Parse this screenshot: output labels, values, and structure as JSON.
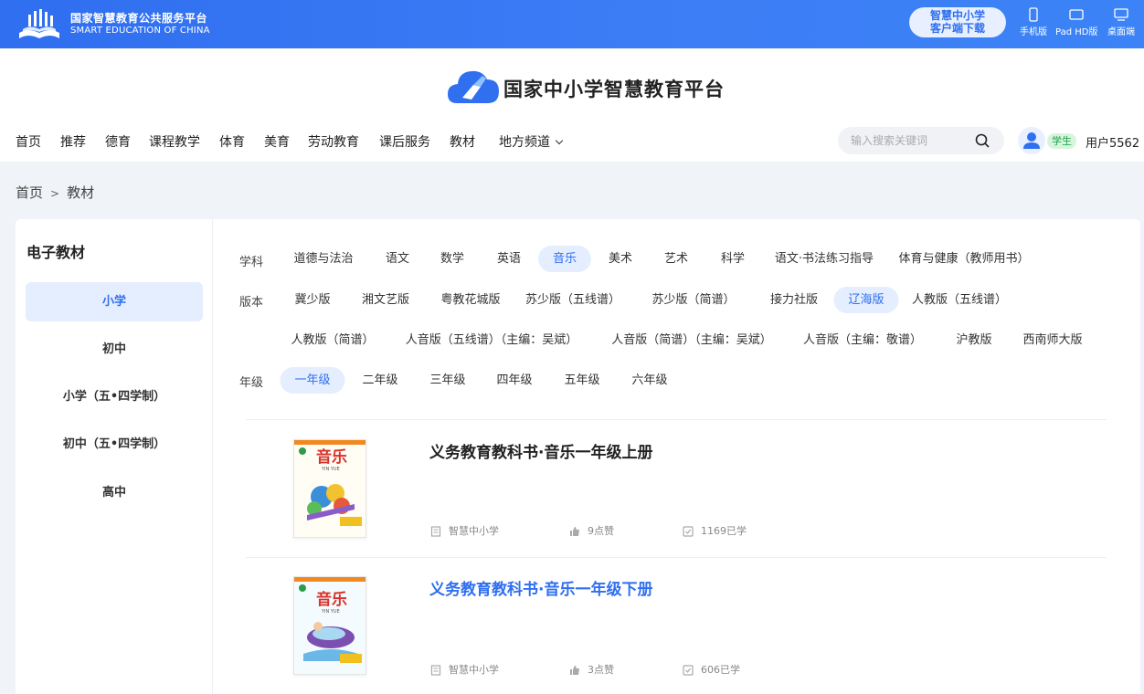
{
  "topbar": {
    "brand_cn": "国家智慧教育公共服务平台",
    "brand_en": "SMART EDUCATION OF CHINA",
    "download_line1": "智慧中小学",
    "download_line2": "客户端下载",
    "devices": [
      "手机版",
      "Pad HD版",
      "桌面端"
    ]
  },
  "header": {
    "site_title": "国家中小学智慧教育平台",
    "nav": [
      "首页",
      "推荐",
      "德育",
      "课程教学",
      "体育",
      "美育",
      "劳动教育",
      "课后服务",
      "教材",
      "地方频道"
    ],
    "search_placeholder": "输入搜索关键词",
    "role_badge": "学生",
    "user_name": "用户5562"
  },
  "breadcrumb": {
    "home": "首页",
    "sep": ">",
    "current": "教材"
  },
  "sidebar": {
    "title": "电子教材",
    "items": [
      "小学",
      "初中",
      "小学（五•四学制）",
      "初中（五•四学制）",
      "高中"
    ],
    "active_index": 0
  },
  "filters": {
    "subject_label": "学科",
    "subjects": [
      "道德与法治",
      "语文",
      "数学",
      "英语",
      "音乐",
      "美术",
      "艺术",
      "科学",
      "语文·书法练习指导",
      "体育与健康（教师用书）"
    ],
    "subject_active": "音乐",
    "edition_label": "版本",
    "editions_row1": [
      "冀少版",
      "湘文艺版",
      "粤教花城版",
      "苏少版（五线谱）",
      "苏少版（简谱）",
      "接力社版",
      "辽海版",
      "人教版（五线谱）"
    ],
    "editions_row2": [
      "人教版（简谱）",
      "人音版（五线谱）（主编：吴斌）",
      "人音版（简谱）（主编：吴斌）",
      "人音版（主编：敬谱）",
      "沪教版",
      "西南师大版"
    ],
    "edition_active": "辽海版",
    "grade_label": "年级",
    "grades": [
      "一年级",
      "二年级",
      "三年级",
      "四年级",
      "五年级",
      "六年级"
    ],
    "grade_active": "一年级"
  },
  "books": [
    {
      "title": "义务教育教科书·音乐一年级上册",
      "cover_text": "音乐",
      "cover_sub": "YIN YUE",
      "publisher": "智慧中小学",
      "likes": "9点赞",
      "learners": "1169已学"
    },
    {
      "title": "义务教育教科书·音乐一年级下册",
      "cover_text": "音乐",
      "cover_sub": "YIN YUE",
      "publisher": "智慧中小学",
      "likes": "3点赞",
      "learners": "606已学"
    }
  ],
  "colors": {
    "primary": "#2f6ff0",
    "active_bg": "#e5eeff",
    "topbar": "#3d7df5",
    "badge_green": "#1aa34a"
  }
}
